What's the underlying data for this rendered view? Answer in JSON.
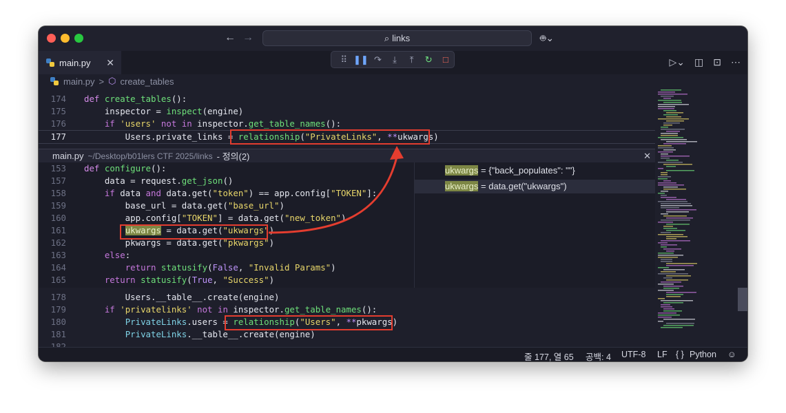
{
  "search": {
    "label": "links"
  },
  "tab": {
    "label": "main.py",
    "close": "✕"
  },
  "breadcrumb": {
    "file": "main.py",
    "sep": ">",
    "symbol": "create_tables"
  },
  "top_lines": [
    {
      "num": "174",
      "tokens": [
        [
          "def",
          "def"
        ],
        [
          " ",
          ""
        ],
        [
          "create_tables",
          "fn"
        ],
        [
          "():",
          ""
        ]
      ]
    },
    {
      "num": "175",
      "tokens": [
        [
          "    inspector = ",
          ""
        ],
        [
          "inspect",
          "fn"
        ],
        [
          "(engine)",
          ""
        ]
      ]
    },
    {
      "num": "176",
      "tokens": [
        [
          "    ",
          ""
        ],
        [
          "if",
          "k"
        ],
        [
          " ",
          ""
        ],
        [
          "'users'",
          "s"
        ],
        [
          " ",
          ""
        ],
        [
          "not in",
          "k"
        ],
        [
          " inspector.",
          ""
        ],
        [
          "get_table_names",
          "fn"
        ],
        [
          "():",
          ""
        ]
      ]
    },
    {
      "num": "177",
      "tokens": [
        [
          "        Users.private_links = ",
          ""
        ],
        [
          "relationship",
          "fn"
        ],
        [
          "(",
          ""
        ],
        [
          "\"PrivateLinks\"",
          "s"
        ],
        [
          ", ",
          ""
        ],
        [
          "**",
          "b"
        ],
        [
          "ukwargs)",
          ""
        ]
      ]
    }
  ],
  "peek": {
    "file": "main.py",
    "path": "~/Desktop/b01lers CTF 2025/links",
    "suffix": "- 정의(2)",
    "close": "✕",
    "lines": [
      {
        "num": "153",
        "tokens": [
          [
            "def",
            "def"
          ],
          [
            " ",
            ""
          ],
          [
            "configure",
            "fn"
          ],
          [
            "():",
            ""
          ]
        ]
      },
      {
        "num": "157",
        "tokens": [
          [
            "    data = request.",
            ""
          ],
          [
            "get_json",
            "fn"
          ],
          [
            "()",
            ""
          ]
        ]
      },
      {
        "num": "158",
        "tokens": [
          [
            "    ",
            ""
          ],
          [
            "if",
            "k"
          ],
          [
            " data ",
            ""
          ],
          [
            "and",
            "k"
          ],
          [
            " data.get(",
            ""
          ],
          [
            "\"token\"",
            "s"
          ],
          [
            ") == app.config[",
            ""
          ],
          [
            "\"TOKEN\"",
            "s"
          ],
          [
            "]:",
            ""
          ]
        ]
      },
      {
        "num": "159",
        "tokens": [
          [
            "        base_url = data.get(",
            ""
          ],
          [
            "\"base_url\"",
            "s"
          ],
          [
            ")",
            ""
          ]
        ]
      },
      {
        "num": "160",
        "tokens": [
          [
            "        app.config[",
            ""
          ],
          [
            "\"TOKEN\"",
            "s"
          ],
          [
            "] = data.get(",
            ""
          ],
          [
            "\"new_token\"",
            "s"
          ],
          [
            ")",
            ""
          ]
        ]
      },
      {
        "num": "161",
        "tokens": [
          [
            "        ",
            ""
          ],
          [
            "ukwargs",
            "hl"
          ],
          [
            " = data.get(",
            ""
          ],
          [
            "\"ukwargs\"",
            "s"
          ],
          [
            ")",
            ""
          ]
        ]
      },
      {
        "num": "162",
        "tokens": [
          [
            "        pkwargs = data.get(",
            ""
          ],
          [
            "\"pkwargs\"",
            "s"
          ],
          [
            ")",
            ""
          ]
        ]
      },
      {
        "num": "163",
        "tokens": [
          [
            "    ",
            ""
          ],
          [
            "else",
            "k"
          ],
          [
            ":",
            ""
          ]
        ]
      },
      {
        "num": "164",
        "tokens": [
          [
            "        ",
            ""
          ],
          [
            "return",
            "k"
          ],
          [
            " ",
            ""
          ],
          [
            "statusify",
            "fn"
          ],
          [
            "(",
            ""
          ],
          [
            "False",
            "b"
          ],
          [
            ", ",
            ""
          ],
          [
            "\"Invalid Params\"",
            "s"
          ],
          [
            ")",
            ""
          ]
        ]
      },
      {
        "num": "165",
        "tokens": [
          [
            "    ",
            ""
          ],
          [
            "return",
            "k"
          ],
          [
            " ",
            ""
          ],
          [
            "statusify",
            "fn"
          ],
          [
            "(",
            ""
          ],
          [
            "True",
            "b"
          ],
          [
            ", ",
            ""
          ],
          [
            "\"Success\"",
            "s"
          ],
          [
            ")",
            ""
          ]
        ]
      }
    ],
    "refs": [
      {
        "word": "ukwargs",
        "rest": " = {\"back_populates\": \"\"}"
      },
      {
        "word": "ukwargs",
        "rest": " = data.get(\"ukwargs\")"
      }
    ]
  },
  "bottom_lines": [
    {
      "num": "178",
      "tokens": [
        [
          "        Users.__table__.create(engine)",
          ""
        ]
      ]
    },
    {
      "num": "179",
      "tokens": [
        [
          "    ",
          ""
        ],
        [
          "if",
          "k"
        ],
        [
          " ",
          ""
        ],
        [
          "'privatelinks'",
          "s"
        ],
        [
          " ",
          ""
        ],
        [
          "not in",
          "k"
        ],
        [
          " inspector.",
          ""
        ],
        [
          "get_table_names",
          "fn"
        ],
        [
          "():",
          ""
        ]
      ]
    },
    {
      "num": "180",
      "tokens": [
        [
          "        ",
          ""
        ],
        [
          "PrivateLinks",
          "cls"
        ],
        [
          ".users = ",
          ""
        ],
        [
          "relationship",
          "fn"
        ],
        [
          "(",
          ""
        ],
        [
          "\"Users\"",
          "s"
        ],
        [
          ", ",
          ""
        ],
        [
          "**",
          "b"
        ],
        [
          "pkwargs)",
          ""
        ]
      ]
    },
    {
      "num": "181",
      "tokens": [
        [
          "        ",
          ""
        ],
        [
          "PrivateLinks",
          "cls"
        ],
        [
          ".__table__.create(engine)",
          ""
        ]
      ]
    },
    {
      "num": "182",
      "tokens": []
    }
  ],
  "status": {
    "position": "줄 177, 열 65",
    "spaces": "공백: 4",
    "encoding": "UTF-8",
    "eol": "LF",
    "braces": "{ }",
    "language": "Python"
  },
  "colors": {
    "highlight": "#e43d2f",
    "accent": "#c678dd"
  }
}
